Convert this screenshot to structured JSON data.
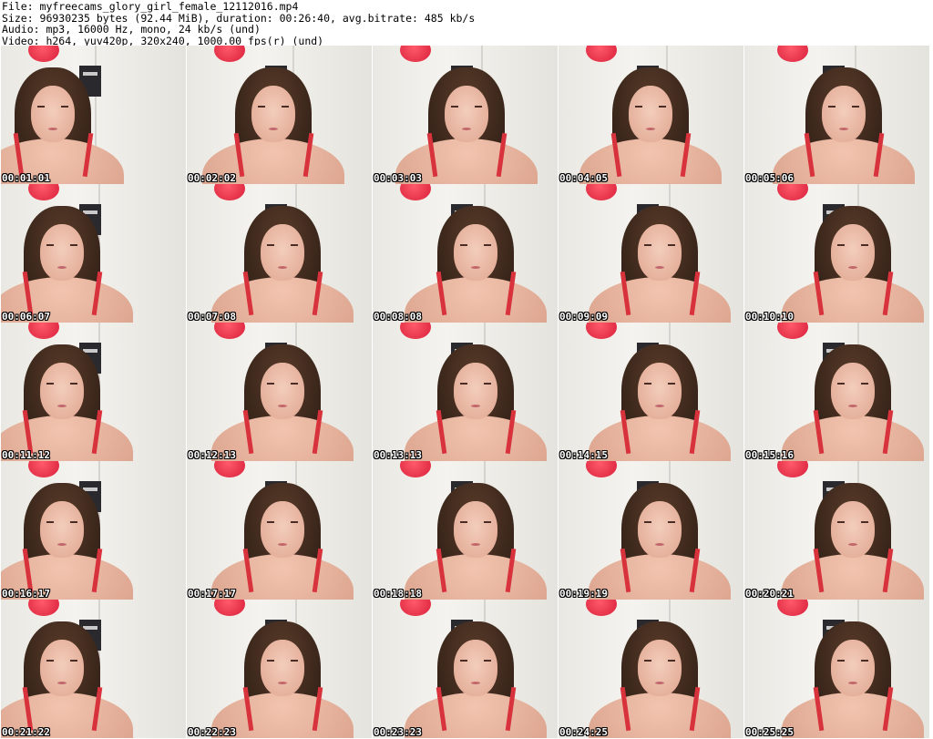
{
  "header": {
    "file": "File: myfreecams_glory_girl_female_12112016.mp4",
    "size": "Size: 96930235 bytes (92.44 MiB), duration: 00:26:40, avg.bitrate: 485 kb/s",
    "audio": "Audio: mp3, 16000 Hz, mono, 24 kb/s (und)",
    "video": "Video: h264, yuv420p, 320x240, 1000.00 fps(r) (und)"
  },
  "frames": [
    {
      "ts": "00:01:01"
    },
    {
      "ts": "00:02:02"
    },
    {
      "ts": "00:03:03"
    },
    {
      "ts": "00:04:05"
    },
    {
      "ts": "00:05:06"
    },
    {
      "ts": "00:06:07"
    },
    {
      "ts": "00:07:08"
    },
    {
      "ts": "00:08:08"
    },
    {
      "ts": "00:09:09"
    },
    {
      "ts": "00:10:10"
    },
    {
      "ts": "00:11:12"
    },
    {
      "ts": "00:12:13"
    },
    {
      "ts": "00:13:13"
    },
    {
      "ts": "00:14:15"
    },
    {
      "ts": "00:15:16"
    },
    {
      "ts": "00:16:17"
    },
    {
      "ts": "00:17:17"
    },
    {
      "ts": "00:18:18"
    },
    {
      "ts": "00:19:19"
    },
    {
      "ts": "00:20:21"
    },
    {
      "ts": "00:21:22"
    },
    {
      "ts": "00:22:23"
    },
    {
      "ts": "00:23:23"
    },
    {
      "ts": "00:24:25"
    },
    {
      "ts": "00:25:25"
    }
  ]
}
